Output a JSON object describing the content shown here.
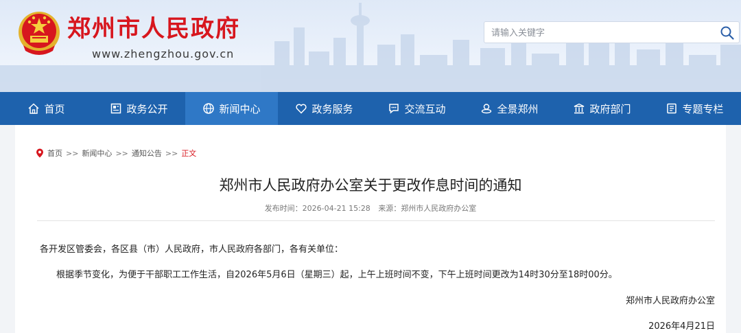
{
  "header": {
    "site_name": "郑州市人民政府",
    "site_url": "www.zhengzhou.gov.cn",
    "search_placeholder": "请输入关键字"
  },
  "nav": {
    "items": [
      {
        "label": "首页",
        "icon": "home-icon"
      },
      {
        "label": "政务公开",
        "icon": "document-icon"
      },
      {
        "label": "新闻中心",
        "icon": "globe-icon",
        "active": true
      },
      {
        "label": "政务服务",
        "icon": "heart-icon"
      },
      {
        "label": "交流互动",
        "icon": "chat-icon"
      },
      {
        "label": "全景郑州",
        "icon": "panorama-icon"
      },
      {
        "label": "政府部门",
        "icon": "building-icon"
      },
      {
        "label": "专题专栏",
        "icon": "book-icon"
      }
    ]
  },
  "breadcrumb": {
    "items": [
      "首页",
      "新闻中心",
      "通知公告",
      "正文"
    ],
    "separator": ">>"
  },
  "article": {
    "title": "郑州市人民政府办公室关于更改作息时间的通知",
    "publish_label": "发布时间：2026-04-21 15:28",
    "source_label": "来源：郑州市人民政府办公室",
    "recipients": "各开发区管委会，各区县（市）人民政府，市人民政府各部门，各有关单位：",
    "body": "根据季节变化，为便于干部职工工作生活，自2026年5月6日（星期三）起，上午上班时间不变，下午上班时间更改为14时30分至18时00分。",
    "signature": "郑州市人民政府办公室",
    "date": "2026年4月21日"
  },
  "colors": {
    "brand_red": "#d7161e",
    "nav_blue": "#1e62ad",
    "nav_active": "#2f78c6"
  }
}
